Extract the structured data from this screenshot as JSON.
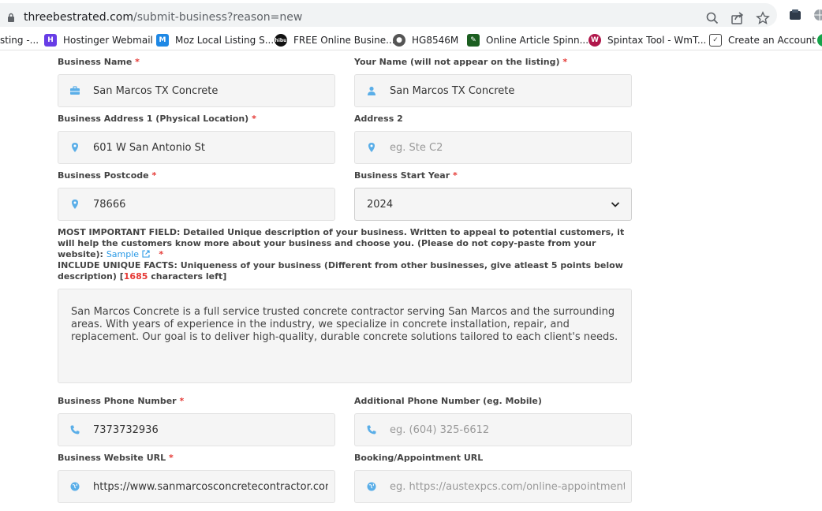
{
  "browser": {
    "url_host": "threebestrated.com",
    "url_path": "/submit-business?reason=new"
  },
  "bookmarks": [
    {
      "label": "sting -...",
      "icon": "generic-icon"
    },
    {
      "label": "Hostinger Webmail",
      "icon": "hostinger-icon",
      "color": "#673de6"
    },
    {
      "label": "Moz Local Listing S...",
      "icon": "moz-icon",
      "color": "#1e88e5"
    },
    {
      "label": "FREE Online Busine...",
      "icon": "hibu-icon",
      "color": "#111111"
    },
    {
      "label": "HG8546M",
      "icon": "globe-icon",
      "color": "#555555"
    },
    {
      "label": "Online Article Spinn...",
      "icon": "spinner-icon",
      "color": "#1b5e20"
    },
    {
      "label": "Spintax Tool - WmT...",
      "icon": "wm-icon",
      "color": "#b0174b"
    },
    {
      "label": "Create an Account",
      "icon": "account-icon",
      "color": "#444444"
    }
  ],
  "form": {
    "business_name": {
      "label": "Business Name",
      "value": "San Marcos TX Concrete"
    },
    "your_name": {
      "label": "Your Name (will not appear on the listing)",
      "value": "San Marcos TX Concrete"
    },
    "address1": {
      "label": "Business Address 1 (Physical Location)",
      "value": "601 W San Antonio St"
    },
    "address2": {
      "label": "Address 2",
      "placeholder": "eg. Ste C2"
    },
    "postcode": {
      "label": "Business Postcode",
      "value": "78666"
    },
    "start_year": {
      "label": "Business Start Year",
      "value": "2024"
    },
    "desc_note": "MOST IMPORTANT FIELD: Detailed Unique description of your business. Written to appeal to potential customers, it will help the customers know more about your business and choose you. (Please do not copy-paste from your website):",
    "sample_link": "Sample",
    "unique_note": "INCLUDE UNIQUE FACTS: Uniqueness of your business (Different from other businesses, give atleast 5 points below description) [",
    "chars_left": "1685",
    "chars_suffix": "characters left]",
    "description": "San Marcos Concrete is a full service trusted concrete contractor serving San Marcos and the surrounding areas. With years of experience in the industry, we specialize in concrete installation, repair, and replacement. Our goal is to deliver high-quality, durable concrete solutions tailored to each client's needs.",
    "phone": {
      "label": "Business Phone Number",
      "value": "7373732936"
    },
    "additional_phone": {
      "label": "Additional Phone Number (eg. Mobile)",
      "placeholder": "eg. (604) 325-6612"
    },
    "website": {
      "label": "Business Website URL",
      "value": "https://www.sanmarcosconcretecontractor.com"
    },
    "booking": {
      "label": "Booking/Appointment URL",
      "placeholder": "eg. https://austexpcs.com/online-appointment.html"
    }
  },
  "colors": {
    "accent": "#2b9ae6",
    "required": "#e53935",
    "icon": "#5aaee8"
  }
}
